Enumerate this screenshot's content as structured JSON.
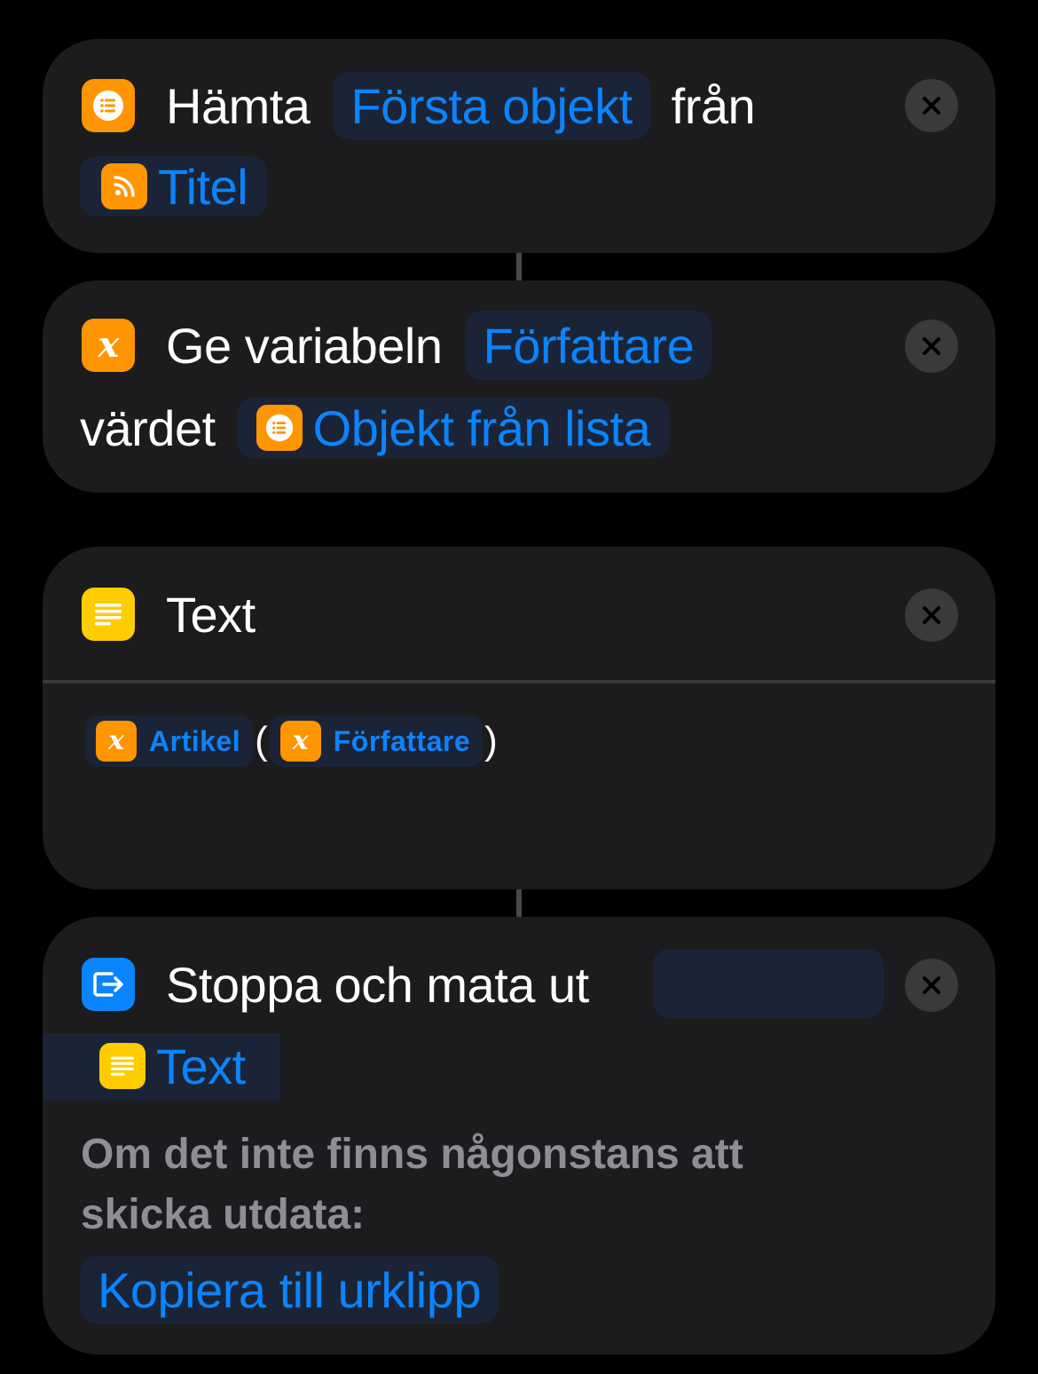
{
  "card1": {
    "verb": "Hämta",
    "selector": "Första objekt",
    "preposition": "från",
    "source_token": "Titel",
    "icon": "list-icon",
    "source_icon": "rss-icon"
  },
  "card2": {
    "verb": "Ge variabeln",
    "variable": "Författare",
    "second_word": "värdet",
    "value_token": "Objekt från lista",
    "icon": "variable-x-icon",
    "value_icon": "list-icon"
  },
  "card3": {
    "title": "Text",
    "icon": "text-lines-icon",
    "token1": "Artikel",
    "open_paren": "(",
    "token2": "Författare",
    "close_paren": ")"
  },
  "card4": {
    "verb": "Stoppa och mata ut",
    "output_token": "Text",
    "fallback_label": "Om det inte finns någonstans att skicka utdata:",
    "fallback_action": "Kopiera till urklipp",
    "icon": "output-arrow-icon"
  },
  "colors": {
    "background": "#000000",
    "card": "#1c1c1e",
    "accent_blue": "#0a84ff",
    "pill_bg": "#1a2436",
    "orange": "#ff9500",
    "yellow": "#ffcc00",
    "secondary_text": "#8e8e93"
  }
}
